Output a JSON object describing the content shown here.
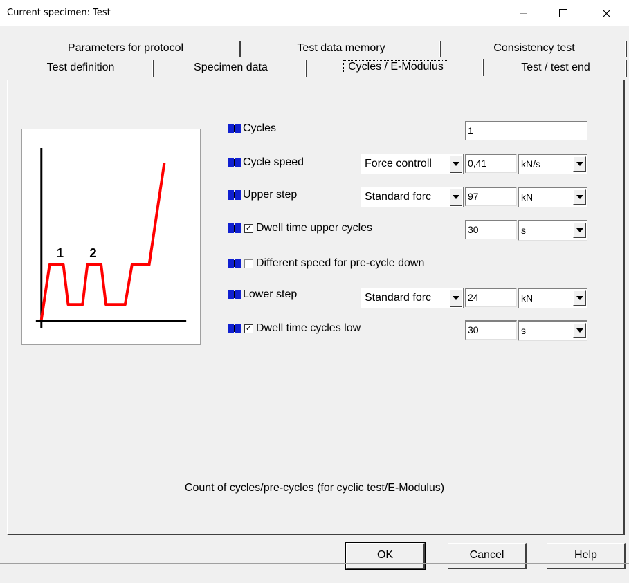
{
  "window": {
    "title": "Current specimen: Test",
    "controls": {
      "minimize": "minimize-icon",
      "maximize": "maximize-icon",
      "close": "close-icon"
    }
  },
  "tabs": {
    "row1": [
      {
        "label": "Parameters for protocol"
      },
      {
        "label": "Test data memory"
      },
      {
        "label": "Consistency test"
      }
    ],
    "row2": [
      {
        "label": "Test definition"
      },
      {
        "label": "Specimen data"
      },
      {
        "label": "Cycles / E-Modulus",
        "active": true
      },
      {
        "label": "Test / test end"
      }
    ]
  },
  "diagram": {
    "labels": [
      "1",
      "2"
    ],
    "line_color": "#ff0000"
  },
  "form": {
    "cycles": {
      "label": "Cycles",
      "value": "1"
    },
    "cycle_speed": {
      "label": "Cycle speed",
      "mode": "Force controll",
      "value": "0,41",
      "unit": "kN/s"
    },
    "upper_step": {
      "label": "Upper step",
      "mode": "Standard forc",
      "value": "97",
      "unit": "kN"
    },
    "dwell_upper": {
      "label": "Dwell time upper cycles",
      "checked": true,
      "value": "30",
      "unit": "s"
    },
    "diff_speed": {
      "label": "Different speed for pre-cycle down",
      "checked": false
    },
    "lower_step": {
      "label": "Lower step",
      "mode": "Standard forc",
      "value": "24",
      "unit": "kN"
    },
    "dwell_low": {
      "label": "Dwell time cycles low",
      "checked": true,
      "value": "30",
      "unit": "s"
    }
  },
  "hint": "Count of cycles/pre-cycles (for cyclic test/E-Modulus)",
  "buttons": {
    "ok": {
      "label": "OK"
    },
    "cancel": {
      "label": "Cancel"
    },
    "help": {
      "label": "Help"
    }
  },
  "colors": {
    "flag": "#1020d0",
    "background": "#f0f0f0"
  }
}
